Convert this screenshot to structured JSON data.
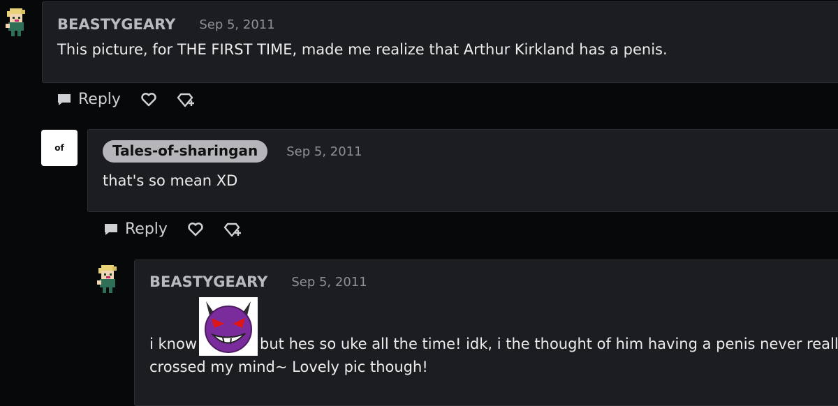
{
  "comments": [
    {
      "author": "BEASTYGEARY",
      "date": "Sep 5, 2011",
      "text": "This picture, for THE FIRST TIME, made me realize that Arthur Kirkland has a penis.",
      "reply_label": "Reply"
    },
    {
      "author": "Tales-of-sharingan",
      "avatar_text": "of",
      "date": "Sep 5, 2011",
      "text": "that's so mean XD",
      "reply_label": "Reply"
    },
    {
      "author": "BEASTYGEARY",
      "date": "Sep 5, 2011",
      "text_before": "i know",
      "text_after": "but hes so uke all the time! idk, i the thought of him having a penis never really",
      "text_line2": "crossed my mind~ Lovely pic though!"
    }
  ],
  "colors": {
    "background": "#07080a",
    "card": "#1c1d21",
    "author_pill": "#b6b6ba",
    "emote_purple": "#7a2c9c"
  },
  "icons": [
    "chat-bubble-icon",
    "heart-icon",
    "award-badge-icon",
    "devil-emote-icon"
  ]
}
